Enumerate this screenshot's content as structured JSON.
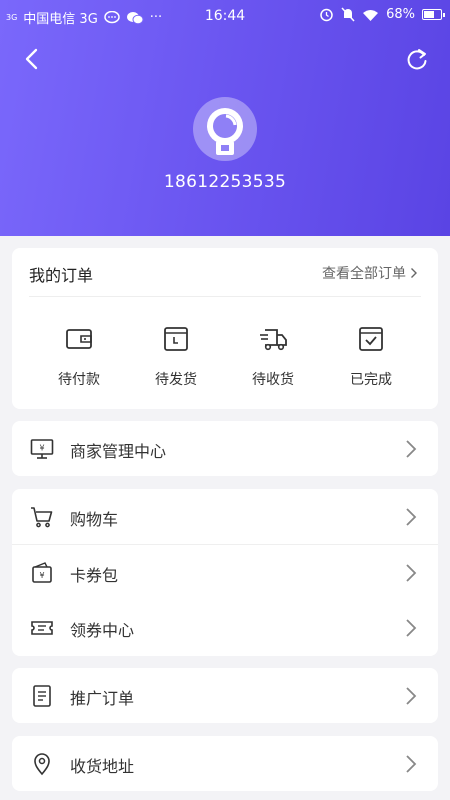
{
  "status_bar": {
    "signal_small": "3G",
    "carrier": "中国电信 3G",
    "dots": "···",
    "time": "16:44",
    "battery_text": "68%",
    "battery_level": 0.68
  },
  "header": {
    "back_icon": "back-arrow-icon",
    "refresh_icon": "refresh-icon",
    "phone": "18612253535"
  },
  "orders": {
    "title": "我的订单",
    "view_all": "查看全部订单",
    "items": [
      {
        "label": "待付款",
        "icon": "wallet-icon"
      },
      {
        "label": "待发货",
        "icon": "clock-box-icon"
      },
      {
        "label": "待收货",
        "icon": "truck-icon"
      },
      {
        "label": "已完成",
        "icon": "check-box-icon"
      }
    ]
  },
  "menu": {
    "merchant": {
      "label": "商家管理中心",
      "icon": "monitor-icon"
    },
    "cart": {
      "label": "购物车",
      "icon": "cart-icon"
    },
    "coupons": {
      "label": "卡券包",
      "icon": "coupon-wallet-icon"
    },
    "coupon_center": {
      "label": "领券中心",
      "icon": "ticket-icon"
    },
    "promo_orders": {
      "label": "推广订单",
      "icon": "document-icon"
    },
    "address": {
      "label": "收货地址",
      "icon": "location-pin-icon"
    }
  },
  "colors": {
    "header_start": "#7a68fb",
    "header_end": "#5a44e4",
    "background": "#f3f3f6"
  }
}
